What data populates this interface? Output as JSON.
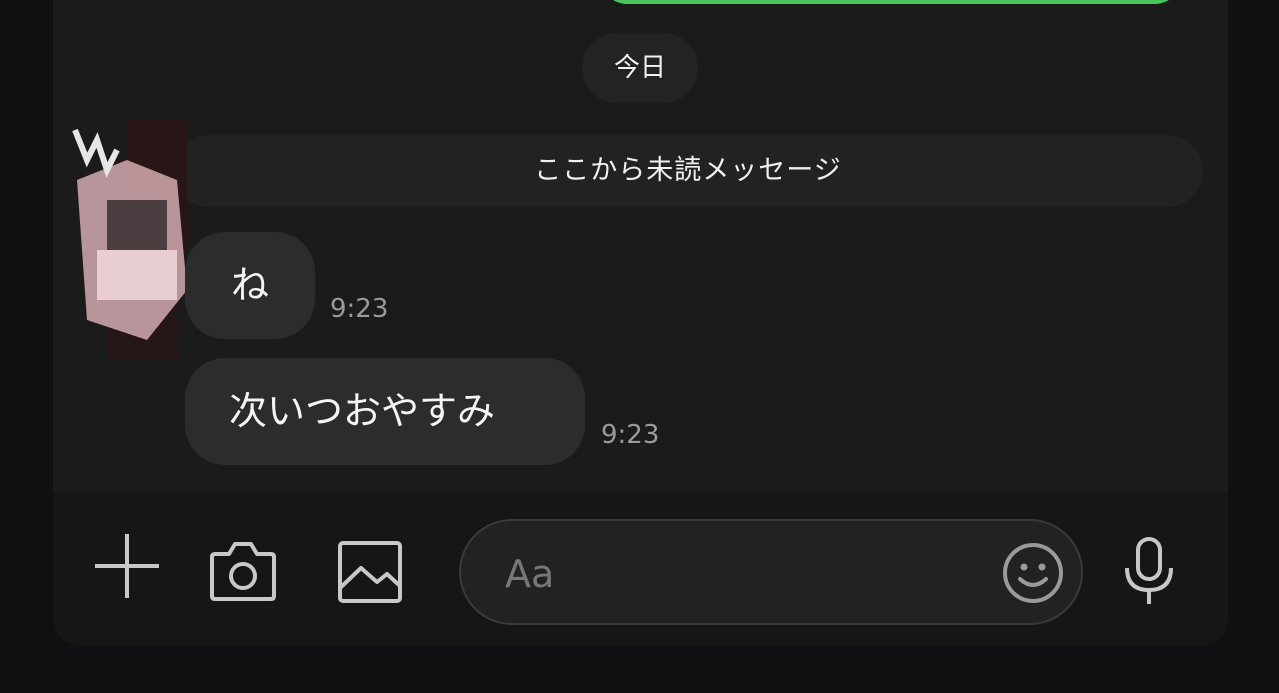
{
  "chat": {
    "date_label": "今日",
    "unread_label": "ここから未読メッセージ",
    "messages": [
      {
        "text": "ね",
        "time": "9:23"
      },
      {
        "text": "次いつおやすみ",
        "time": "9:23"
      }
    ]
  },
  "input": {
    "placeholder": "Aa"
  },
  "icons": {
    "add": "plus-icon",
    "camera": "camera-icon",
    "image": "image-icon",
    "emoji": "smiley-icon",
    "mic": "microphone-icon"
  },
  "colors": {
    "background": "#1b1b1b",
    "bubble": "#2c2c2c",
    "sent_bubble_border": "#4ac45a",
    "time_text": "#9a9a9a",
    "icon": "#bdbdbd"
  }
}
